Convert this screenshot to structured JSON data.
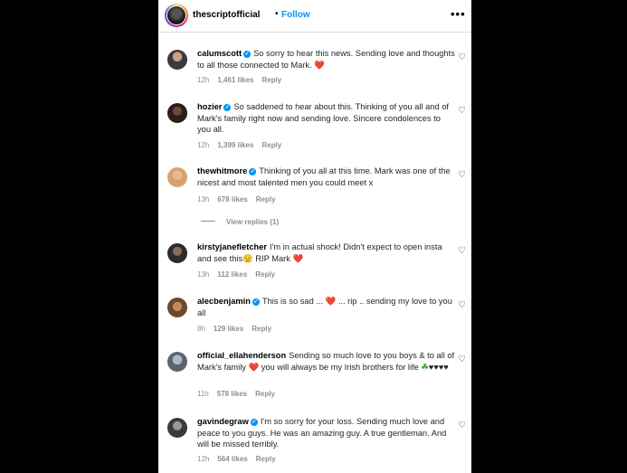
{
  "header": {
    "username": "thescriptofficial",
    "dot": "•",
    "follow_label": "Follow",
    "more_icon": "more-horizontal-icon",
    "more_glyph": "•••"
  },
  "colors": {
    "follow_blue": "#0095f6",
    "heart_red": "#e0245e",
    "meta_grey": "#8e8e8e"
  },
  "verified_glyph": "✓",
  "like_icon_glyph": "♡",
  "comments": [
    {
      "username": "calumscott",
      "verified": true,
      "text_parts": [
        "So sorry to hear this news. Sending love and thoughts to all those connected to Mark. ",
        "❤️"
      ],
      "time": "12h",
      "likes": "1,461 likes",
      "reply": "Reply"
    },
    {
      "username": "hozier",
      "verified": true,
      "text_parts": [
        "So saddened to hear about this. Thinking of you all and of Mark's family right now and sending love. Sincere condolences to you all."
      ],
      "time": "12h",
      "likes": "1,399 likes",
      "reply": "Reply"
    },
    {
      "username": "thewhitmore",
      "verified": true,
      "text_parts": [
        "Thinking of you all at this time. Mark was one of the nicest and most talented men you could meet x"
      ],
      "time": "13h",
      "likes": "678 likes",
      "reply": "Reply",
      "view_replies": "View replies (1)"
    },
    {
      "username": "kirstyjanefletcher",
      "verified": false,
      "text_parts": [
        "I'm in actual shock! Didn't expect to open insta and see this",
        "😟",
        " RIP Mark ",
        "❤️"
      ],
      "time": "13h",
      "likes": "112 likes",
      "reply": "Reply"
    },
    {
      "username": "alecbenjamin",
      "verified": true,
      "text_parts": [
        "This is so sad ... ",
        "❤️",
        " ... rip .. sending my love to you all"
      ],
      "time": "8h",
      "likes": "129 likes",
      "reply": "Reply"
    },
    {
      "username": "official_ellahenderson",
      "verified": false,
      "text_parts": [
        "Sending so much love to you boys & to all of Mark's family ",
        "❤️",
        " you will always be my Irish brothers for life ",
        "☘",
        "♥♥♥♥"
      ],
      "time": "11h",
      "likes": "578 likes",
      "reply": "Reply"
    },
    {
      "username": "gavindegraw",
      "verified": true,
      "text_parts": [
        "I'm so sorry for your loss. Sending much love and peace to you guys. He was an amazing guy. A true gentleman. And will be missed terribly."
      ],
      "time": "12h",
      "likes": "564 likes",
      "reply": "Reply"
    }
  ]
}
